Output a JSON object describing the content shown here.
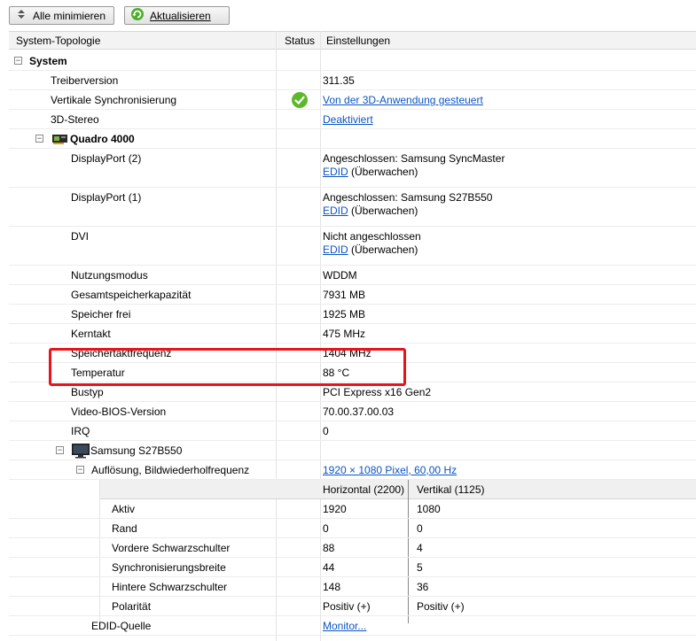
{
  "toolbar": {
    "collapse_all": "Alle minimieren",
    "refresh": "Aktualisieren"
  },
  "columns": {
    "topology": "System-Topologie",
    "status": "Status",
    "settings": "Einstellungen"
  },
  "tree": {
    "system": "System",
    "driver_version_label": "Treiberversion",
    "driver_version_value": "311.35",
    "vsync_label": "Vertikale Synchronisierung",
    "vsync_value": "Von der 3D-Anwendung gesteuert",
    "stereo_label": "3D-Stereo",
    "stereo_value": "Deaktiviert",
    "gpu_name": "Quadro 4000",
    "dp2_label": "DisplayPort (2)",
    "dp2_value": "Angeschlossen: Samsung SyncMaster",
    "dp1_label": "DisplayPort (1)",
    "dp1_value": "Angeschlossen: Samsung S27B550",
    "dvi_label": "DVI",
    "dvi_value": "Nicht angeschlossen",
    "edid_link": "EDID",
    "edid_suffix": "(Überwachen)",
    "usage_mode_label": "Nutzungsmodus",
    "usage_mode_value": "WDDM",
    "total_memory_label": "Gesamtspeicherkapazität",
    "total_memory_value": "7931 MB",
    "free_memory_label": "Speicher frei",
    "free_memory_value": "1925 MB",
    "core_clock_label": "Kerntakt",
    "core_clock_value": "475 MHz",
    "mem_clock_label": "Speichertaktfrequenz",
    "mem_clock_value": "1404 MHz",
    "temperature_label": "Temperatur",
    "temperature_value": "88 °C",
    "bus_label": "Bustyp",
    "bus_value": "PCI Express x16 Gen2",
    "bios_label": "Video-BIOS-Version",
    "bios_value": "70.00.37.00.03",
    "irq_label": "IRQ",
    "irq_value": "0",
    "monitor_name": "Samsung S27B550",
    "resolution_label": "Auflösung, Bildwiederholfrequenz",
    "resolution_value": "1920 × 1080 Pixel, 60,00 Hz",
    "horizontal_header": "Horizontal (2200)",
    "vertical_header": "Vertikal (1125)",
    "active_label": "Aktiv",
    "active_h": "1920",
    "active_v": "1080",
    "border_label": "Rand",
    "border_h": "0",
    "border_v": "0",
    "front_porch_label": "Vordere Schwarzschulter",
    "front_porch_h": "88",
    "front_porch_v": "4",
    "sync_width_label": "Synchronisierungsbreite",
    "sync_width_h": "44",
    "sync_width_v": "5",
    "back_porch_label": "Hintere Schwarzschulter",
    "back_porch_h": "148",
    "back_porch_v": "36",
    "polarity_label": "Polarität",
    "polarity_h": "Positiv (+)",
    "polarity_v": "Positiv (+)",
    "edid_source_label": "EDID-Quelle",
    "edid_source_value": "Monitor..."
  },
  "colors": {
    "link": "#0b55c4",
    "highlight": "#e8141b",
    "status_ok": "#5cb82a"
  }
}
